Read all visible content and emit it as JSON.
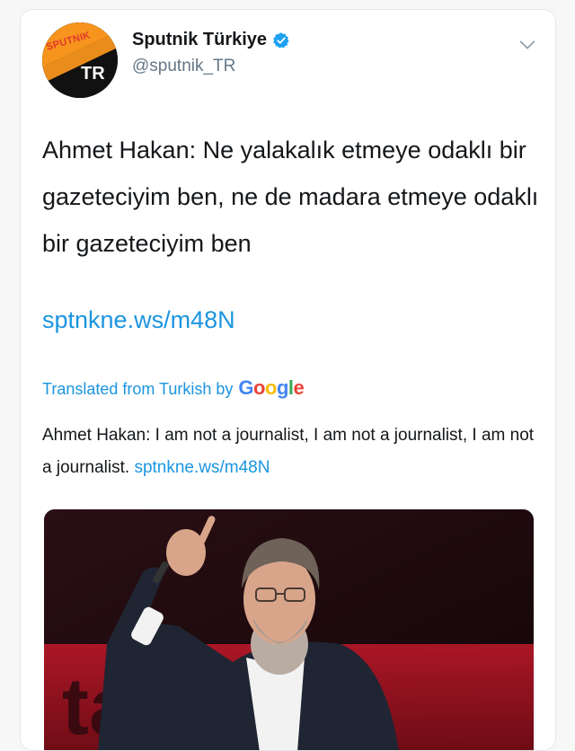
{
  "account": {
    "display_name": "Sputnik Türkiye",
    "handle": "@sputnik_TR",
    "verified": true,
    "avatar_brand": "SPUTNIK",
    "avatar_sub": "TR"
  },
  "tweet": {
    "text": "Ahmet Hakan: Ne yalakalık etmeye odaklı bir gazeteciyim ben, ne de madara etmeye odaklı bir gazeteciyim ben",
    "link": "sptnkne.ws/m48N"
  },
  "translation": {
    "label": "Translated from Turkish by",
    "provider_letters": [
      "G",
      "o",
      "o",
      "g",
      "l",
      "e"
    ],
    "text": "Ahmet Hakan: I am not a journalist, I am not a journalist, I am not a journalist.",
    "link": "sptnkne.ws/m48N"
  },
  "media": {
    "background_text": "ta bö"
  },
  "colors": {
    "link": "#1b95e0",
    "text": "#14171a",
    "muted": "#657786",
    "verified": "#1da1f2",
    "avatar_accent": "#f7941d"
  },
  "icons": {
    "verified": "verified-badge-icon",
    "menu": "chevron-down-icon"
  }
}
